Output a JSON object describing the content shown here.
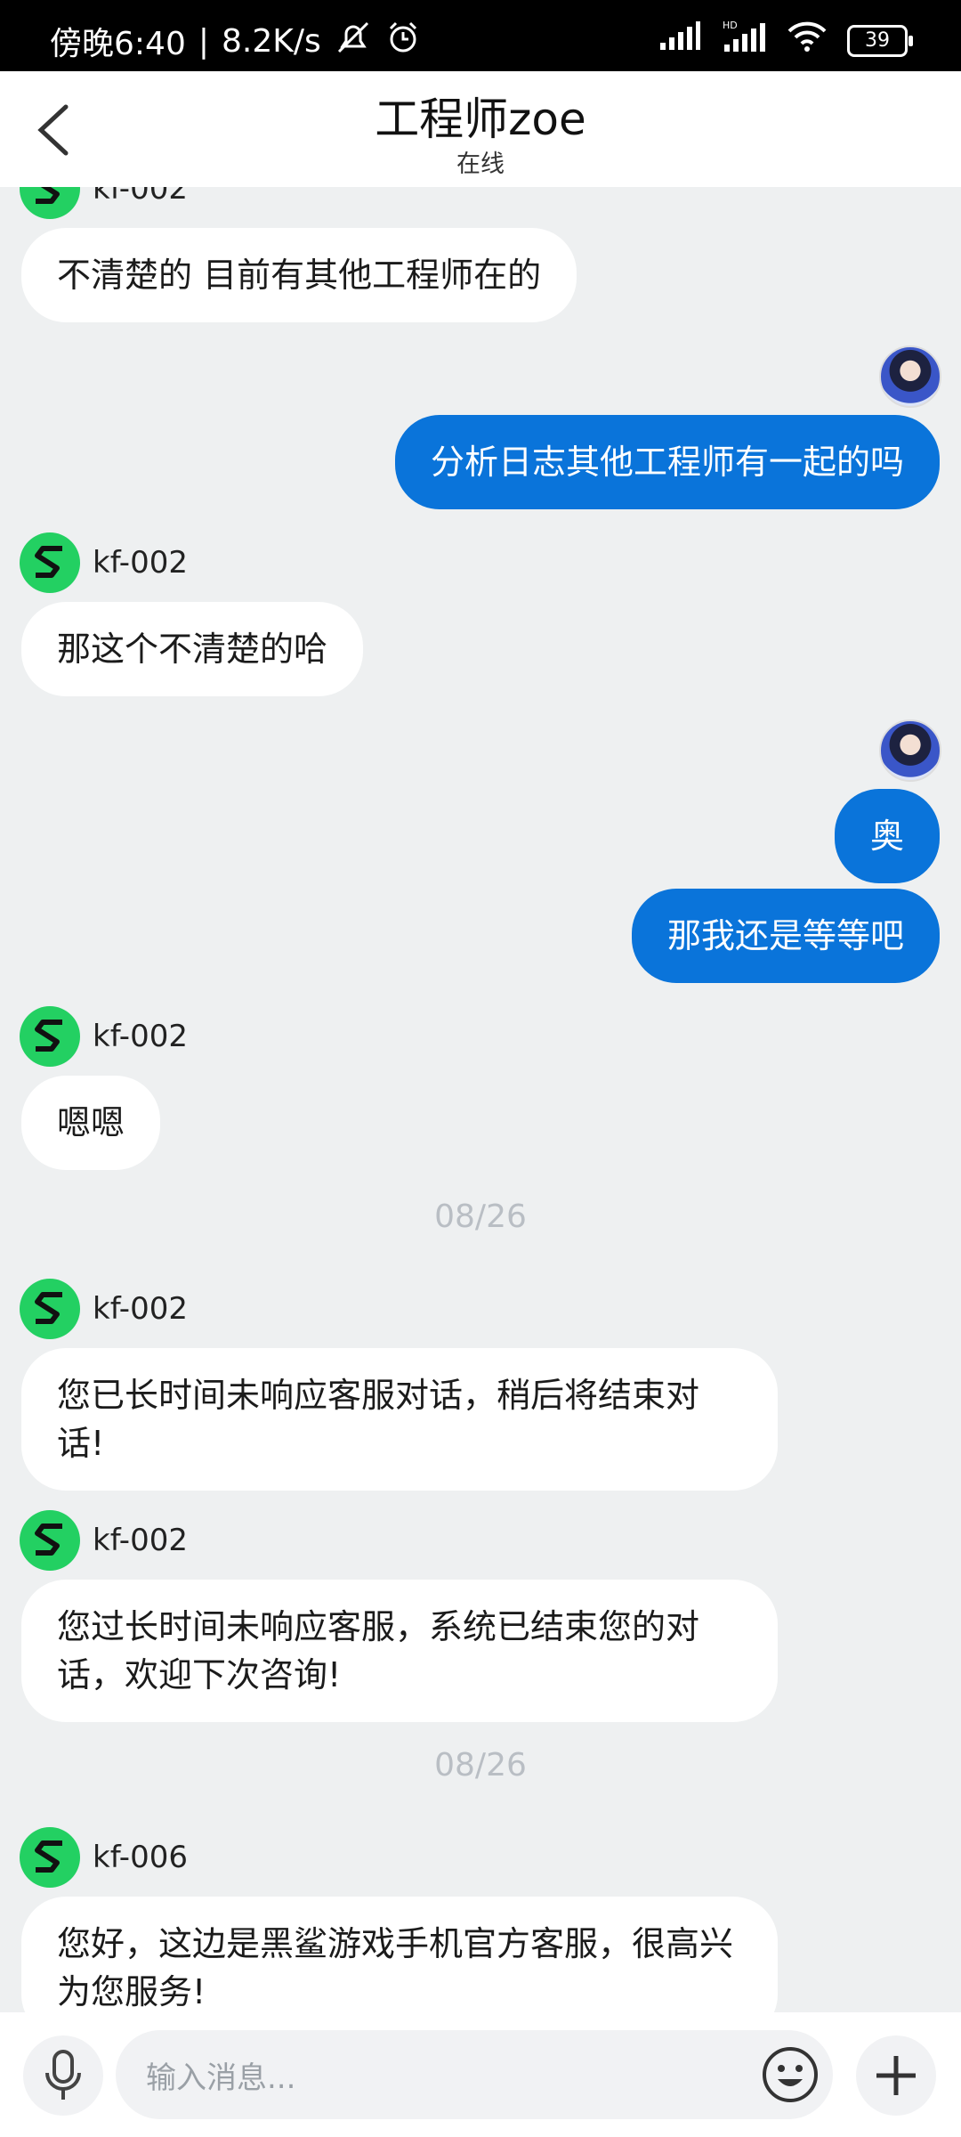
{
  "status_bar": {
    "time_text": "傍晚6:40",
    "separator": "|",
    "net_speed": "8.2K/s",
    "battery": "39",
    "icons": [
      "notifications-off-icon",
      "alarm-icon",
      "signal-icon",
      "hd-signal-icon",
      "wifi-icon",
      "battery-icon"
    ]
  },
  "header": {
    "title": "工程师zoe",
    "subtitle": "在线"
  },
  "messages": [
    {
      "side": "in",
      "sender": "kf-002",
      "text": "不清楚的 目前有其他工程师在的"
    },
    {
      "side": "out",
      "text": "分析日志其他工程师有一起的吗"
    },
    {
      "side": "in",
      "sender": "kf-002",
      "text": "那这个不清楚的哈"
    },
    {
      "side": "out",
      "text": "奥"
    },
    {
      "side": "out",
      "text": "那我还是等等吧"
    },
    {
      "side": "in",
      "sender": "kf-002",
      "text": "嗯嗯"
    },
    {
      "type": "timestamp",
      "text": "08/26"
    },
    {
      "side": "in",
      "sender": "kf-002",
      "text": "您已长时间未响应客服对话，稍后将结束对话!"
    },
    {
      "side": "in",
      "sender": "kf-002",
      "text": "您过长时间未响应客服，系统已结束您的对话，欢迎下次咨询!"
    },
    {
      "type": "timestamp",
      "text": "08/26"
    },
    {
      "side": "in",
      "sender": "kf-006",
      "text": "您好，这边是黑鲨游戏手机官方客服，很高兴为您服务!"
    }
  ],
  "input": {
    "placeholder": "输入消息..."
  },
  "colors": {
    "accent": "#0a74da",
    "agent_avatar": "#23d062",
    "background": "#eef0f1"
  }
}
